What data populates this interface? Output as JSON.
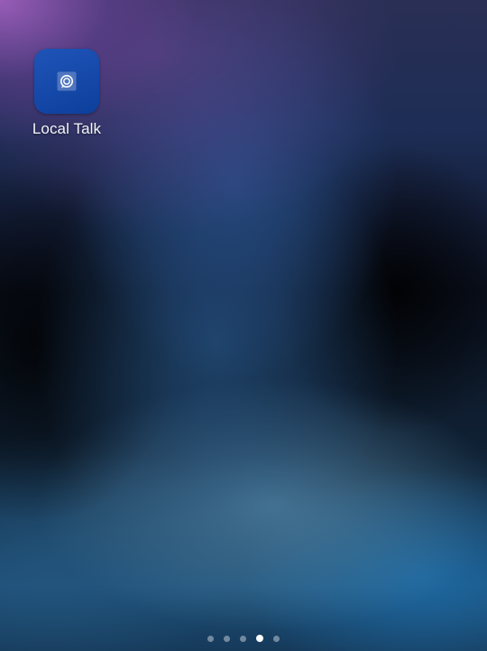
{
  "home_screen": {
    "apps": [
      {
        "label": "Local Talk",
        "icon": "chat-bubble-icon",
        "tile_color": "#1648a8"
      }
    ],
    "page_indicator": {
      "total_pages": 5,
      "current_page": 4
    }
  }
}
